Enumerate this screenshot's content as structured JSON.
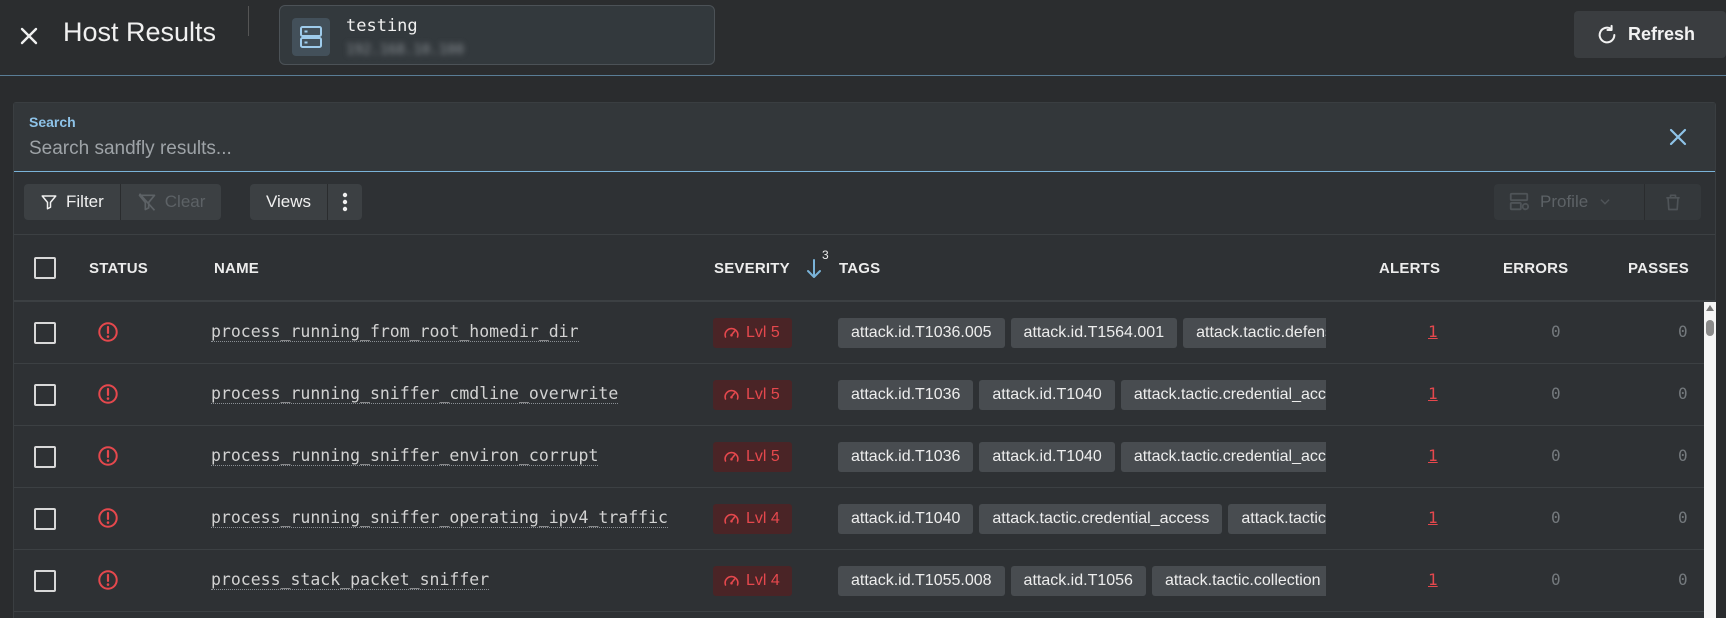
{
  "header": {
    "title": "Host Results",
    "host_name": "testing",
    "host_ip": "192.168.10.100",
    "refresh_label": "Refresh"
  },
  "search": {
    "label": "Search",
    "placeholder": "Search sandfly results..."
  },
  "toolbar": {
    "filter_label": "Filter",
    "clear_label": "Clear",
    "views_label": "Views",
    "profile_label": "Profile"
  },
  "table": {
    "columns": {
      "status": "STATUS",
      "name": "NAME",
      "severity": "SEVERITY",
      "sort_index": "3",
      "tags": "TAGS",
      "alerts": "ALERTS",
      "errors": "ERRORS",
      "passes": "PASSES"
    },
    "rows": [
      {
        "name": "process_running_from_root_homedir_dir",
        "severity": "Lvl 5",
        "tags": [
          "attack.id.T1036.005",
          "attack.id.T1564.001",
          "attack.tactic.defense_evasion"
        ],
        "alerts": "1",
        "errors": "0",
        "passes": "0"
      },
      {
        "name": "process_running_sniffer_cmdline_overwrite",
        "severity": "Lvl 5",
        "tags": [
          "attack.id.T1036",
          "attack.id.T1040",
          "attack.tactic.credential_access"
        ],
        "alerts": "1",
        "errors": "0",
        "passes": "0"
      },
      {
        "name": "process_running_sniffer_environ_corrupt",
        "severity": "Lvl 5",
        "tags": [
          "attack.id.T1036",
          "attack.id.T1040",
          "attack.tactic.credential_access"
        ],
        "alerts": "1",
        "errors": "0",
        "passes": "0"
      },
      {
        "name": "process_running_sniffer_operating_ipv4_traffic",
        "severity": "Lvl 4",
        "tags": [
          "attack.id.T1040",
          "attack.tactic.credential_access",
          "attack.tactic.discovery"
        ],
        "alerts": "1",
        "errors": "0",
        "passes": "0"
      },
      {
        "name": "process_stack_packet_sniffer",
        "severity": "Lvl 4",
        "tags": [
          "attack.id.T1055.008",
          "attack.id.T1056",
          "attack.tactic.collection"
        ],
        "alerts": "1",
        "errors": "0",
        "passes": "0"
      }
    ]
  },
  "colors": {
    "accent": "#7ab3d8",
    "alert_red": "#e5484d",
    "background": "#2a2c2e"
  },
  "icons": {
    "close": "close-icon",
    "host": "server-icon",
    "refresh": "refresh-icon",
    "filter": "filter-icon",
    "clear": "filter-off-icon",
    "more": "more-vertical-icon",
    "profile": "profile-icon",
    "delete": "trash-icon",
    "status": "alert-circle-icon",
    "severity": "gauge-icon",
    "sort": "arrow-down-icon"
  }
}
